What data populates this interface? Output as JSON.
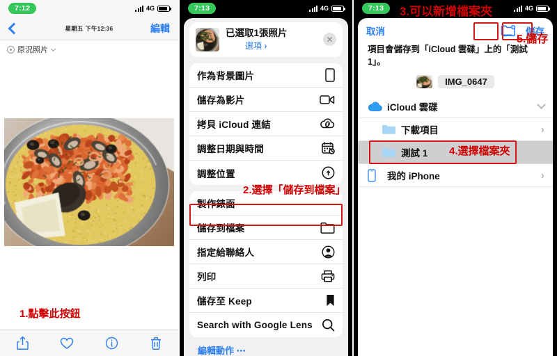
{
  "left_panel": {
    "status": {
      "time": "7:12",
      "network": "4G",
      "signal_icon": "signal-bars-icon",
      "battery_icon": "battery-icon"
    },
    "nav": {
      "back_icon": "back-chevron-icon",
      "date": "星期五 下午12:36",
      "edit_label": "編輯"
    },
    "live_photo": {
      "icon": "live-photo-icon",
      "label": "原況照片",
      "caret_icon": "chevron-down-icon"
    },
    "photo": {
      "alt": "seafood paella in metal pan",
      "name": "photo-paella"
    },
    "toolbar": [
      {
        "name": "share-button",
        "icon": "share-icon"
      },
      {
        "name": "favorite-button",
        "icon": "heart-icon"
      },
      {
        "name": "info-button",
        "icon": "info-circle-icon"
      },
      {
        "name": "delete-button",
        "icon": "trash-icon"
      }
    ]
  },
  "mid_panel": {
    "status": {
      "time": "7:13",
      "network": "4G",
      "signal_icon": "signal-bars-icon",
      "battery_icon": "battery-icon"
    },
    "header": {
      "title": "已選取1張照片",
      "options_label": "選項",
      "options_chevron": "›",
      "close_icon": "close-icon"
    },
    "group_1": [
      {
        "label": "作為背景圖片",
        "icon": "phone-icon"
      },
      {
        "label": "儲存為影片",
        "icon": "video-camera-icon"
      },
      {
        "label": "拷貝 iCloud 連結",
        "icon": "cloud-link-icon"
      },
      {
        "label": "調整日期與時間",
        "icon": "calendar-clock-icon"
      },
      {
        "label": "調整位置",
        "icon": "location-pin-icon"
      }
    ],
    "group_2": [
      {
        "label": "製作錶面",
        "icon": ""
      },
      {
        "label": "儲存到檔案",
        "icon": "folder-icon",
        "highlighted": true
      },
      {
        "label": "指定給聯絡人",
        "icon": "contact-icon"
      },
      {
        "label": "列印",
        "icon": "printer-icon"
      },
      {
        "label": "儲存至 Keep",
        "icon": "bookmark-icon"
      },
      {
        "label": "Search with Google Lens",
        "icon": "search-icon"
      }
    ],
    "edit_actions_label": "編輯動作 ⋯"
  },
  "right_panel": {
    "status": {
      "time": "7:13",
      "network": "4G",
      "signal_icon": "signal-bars-icon",
      "battery_icon": "battery-icon"
    },
    "nav": {
      "cancel_label": "取消",
      "new_folder_icon": "new-folder-icon",
      "save_label": "儲存"
    },
    "description": "項目會儲存到「iCloud 雲碟」上的「測試1」。",
    "file_chip": {
      "name": "IMG_0647",
      "thumb": "photo-thumb"
    },
    "locations": [
      {
        "label": "iCloud 雲碟",
        "icon": "icloud-icon",
        "accessory": "chevron-down",
        "indent": false,
        "selected": false
      },
      {
        "label": "下載項目",
        "icon": "folder-blue-icon",
        "accessory": "›",
        "indent": true,
        "selected": false
      },
      {
        "label": "測試 1",
        "icon": "folder-blue-icon",
        "accessory": "",
        "indent": true,
        "selected": true
      },
      {
        "label": "我的 iPhone",
        "icon": "iphone-icon",
        "accessory": "›",
        "indent": false,
        "selected": false
      }
    ]
  },
  "annotations": [
    {
      "id": 1,
      "text": "1.點擊此按鈕"
    },
    {
      "id": 2,
      "text": "2.選擇「儲存到檔案」"
    },
    {
      "id": 3,
      "text": "3.可以新增檔案夾"
    },
    {
      "id": 4,
      "text": "4.選擇檔案夾"
    },
    {
      "id": 5,
      "text": "5.儲存"
    }
  ],
  "colors": {
    "accent_blue": "#2d7ff0",
    "annotation_red": "#d00000",
    "highlight_box": "#d31717",
    "status_green": "#34c759"
  }
}
